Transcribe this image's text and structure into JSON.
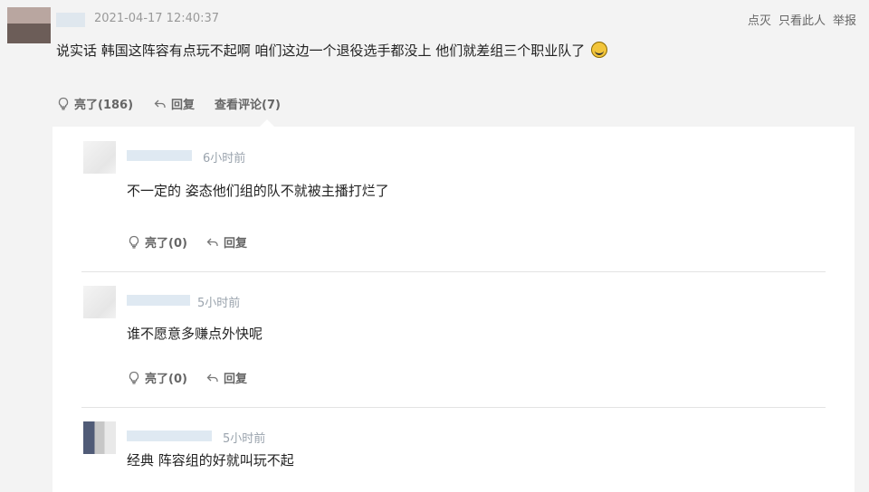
{
  "post": {
    "timestamp": "2021-04-17 12:40:37",
    "top_actions": [
      "点灭",
      "只看此人",
      "举报"
    ],
    "content": "说实话 韩国这阵容有点玩不起啊 咱们这边一个退役选手都没上 他们就差组三个职业队了",
    "actions": {
      "like_label": "亮了(186)",
      "reply_label": "回复",
      "view_comments_label": "查看评论(7)"
    },
    "icons": {
      "like": "lightbulb-icon",
      "reply": "reply-arrow-icon",
      "emoji": "grinning-face-icon"
    }
  },
  "comments": [
    {
      "time": "6小时前",
      "text": "不一定的 姿态他们组的队不就被主播打烂了",
      "like_label": "亮了(0)",
      "reply_label": "回复"
    },
    {
      "time": "5小时前",
      "text": "谁不愿意多赚点外快呢",
      "like_label": "亮了(0)",
      "reply_label": "回复"
    },
    {
      "time": "5小时前",
      "text": "经典 阵容组的好就叫玩不起"
    }
  ],
  "colors": {
    "page_bg": "#f3f3f3",
    "panel_bg": "#ffffff",
    "muted_text": "#999999",
    "divider": "#e3e3e3"
  }
}
